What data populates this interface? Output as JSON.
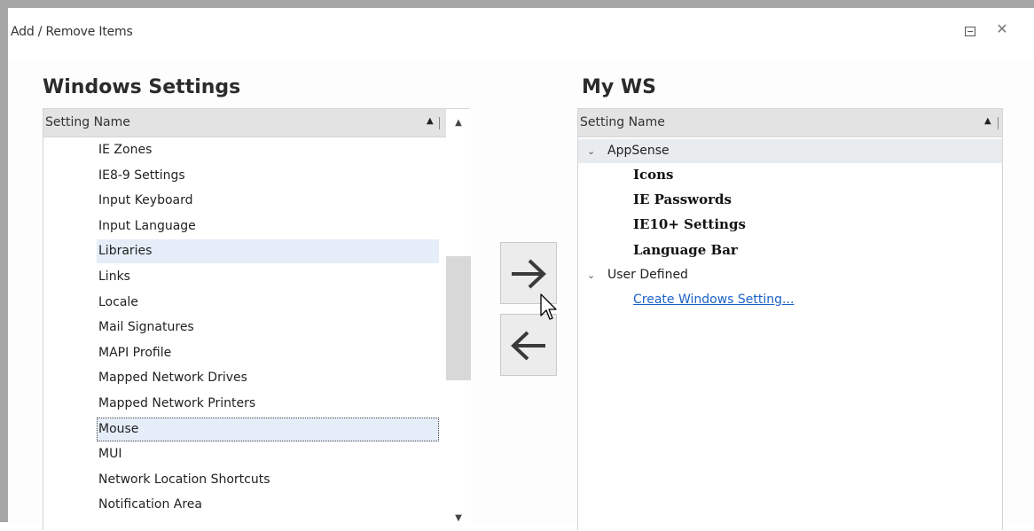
{
  "window": {
    "title": "Add / Remove Items",
    "restore_icon": "restore-icon",
    "close_glyph": "✕"
  },
  "left_panel": {
    "title": "Windows Settings",
    "column_header": "Setting Name",
    "sort_glyph": "▲",
    "scroll_up_glyph": "▲",
    "scroll_down_glyph": "▼",
    "items": [
      "IE Zones",
      "IE8-9 Settings",
      "Input Keyboard",
      "Input Language",
      "Libraries",
      "Links",
      "Locale",
      "Mail Signatures",
      "MAPI Profile",
      "Mapped Network Drives",
      "Mapped Network Printers",
      "Mouse",
      "MUI",
      "Network Location Shortcuts",
      "Notification Area"
    ],
    "hovered_item": "Libraries",
    "selected_item": "Mouse"
  },
  "transfer": {
    "add_icon": "arrow-right-icon",
    "remove_icon": "arrow-left-icon"
  },
  "right_panel": {
    "title": "My WS",
    "column_header": "Setting Name",
    "sort_glyph": "▲",
    "groups": [
      {
        "label": "AppSense",
        "chevron": "⌄",
        "children": [
          "Icons",
          "IE Passwords",
          "IE10+ Settings",
          "Language Bar"
        ]
      },
      {
        "label": "User Defined",
        "chevron": "⌄",
        "link": "Create Windows Setting..."
      }
    ]
  },
  "colors": {
    "selection_bg": "#e5eef8",
    "header_bg": "#e3e3e3",
    "link": "#1a62c8"
  }
}
